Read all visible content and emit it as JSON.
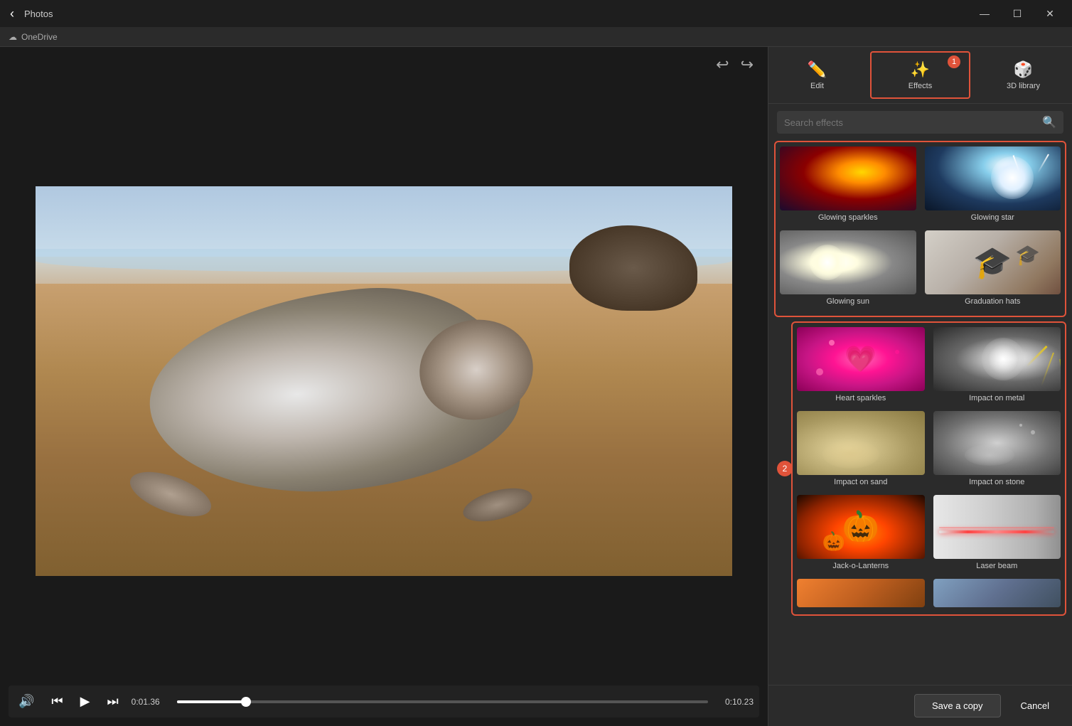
{
  "app": {
    "title": "Photos",
    "back_label": "‹"
  },
  "window_controls": {
    "minimize": "—",
    "maximize": "☐",
    "close": "✕"
  },
  "onedrive": {
    "label": "OneDrive"
  },
  "toolbar": {
    "undo": "↩",
    "redo": "↪"
  },
  "video": {
    "current_time": "0:01.36",
    "total_time": "0:10.23",
    "progress_percent": 13
  },
  "controls": {
    "skip_back": "⏮",
    "play_prev": "⏪",
    "play": "▶",
    "volume": "🔊"
  },
  "tabs": [
    {
      "id": "edit",
      "label": "Edit",
      "icon": "✏️",
      "active": false
    },
    {
      "id": "effects",
      "label": "Effects",
      "icon": "✨",
      "active": true,
      "badge": "1"
    },
    {
      "id": "3d-library",
      "label": "3D library",
      "icon": "🎲",
      "active": false
    }
  ],
  "search": {
    "placeholder": "Search effects",
    "icon": "🔍"
  },
  "effects": [
    {
      "id": "glowing-sparkles",
      "label": "Glowing sparkles",
      "thumb_class": "thumb-glowing-sparkles"
    },
    {
      "id": "glowing-star",
      "label": "Glowing star",
      "thumb_class": "thumb-glowing-star"
    },
    {
      "id": "glowing-sun",
      "label": "Glowing sun",
      "thumb_class": "thumb-glowing-sun"
    },
    {
      "id": "graduation-hats",
      "label": "Graduation hats",
      "thumb_class": "thumb-graduation-hats"
    },
    {
      "id": "heart-sparkles",
      "label": "Heart sparkles",
      "thumb_class": "thumb-heart-sparkles",
      "badge": "2"
    },
    {
      "id": "impact-on-metal",
      "label": "Impact on metal",
      "thumb_class": "thumb-impact-metal"
    },
    {
      "id": "impact-on-sand",
      "label": "Impact on sand",
      "thumb_class": "thumb-impact-sand"
    },
    {
      "id": "impact-on-stone",
      "label": "Impact on stone",
      "thumb_class": "thumb-impact-stone"
    },
    {
      "id": "jack-o-lanterns",
      "label": "Jack-o-Lanterns",
      "thumb_class": "thumb-jack-o-lanterns"
    },
    {
      "id": "laser-beam",
      "label": "Laser beam",
      "thumb_class": "thumb-laser-beam"
    }
  ],
  "actions": {
    "save_copy": "Save a copy",
    "cancel": "Cancel"
  }
}
